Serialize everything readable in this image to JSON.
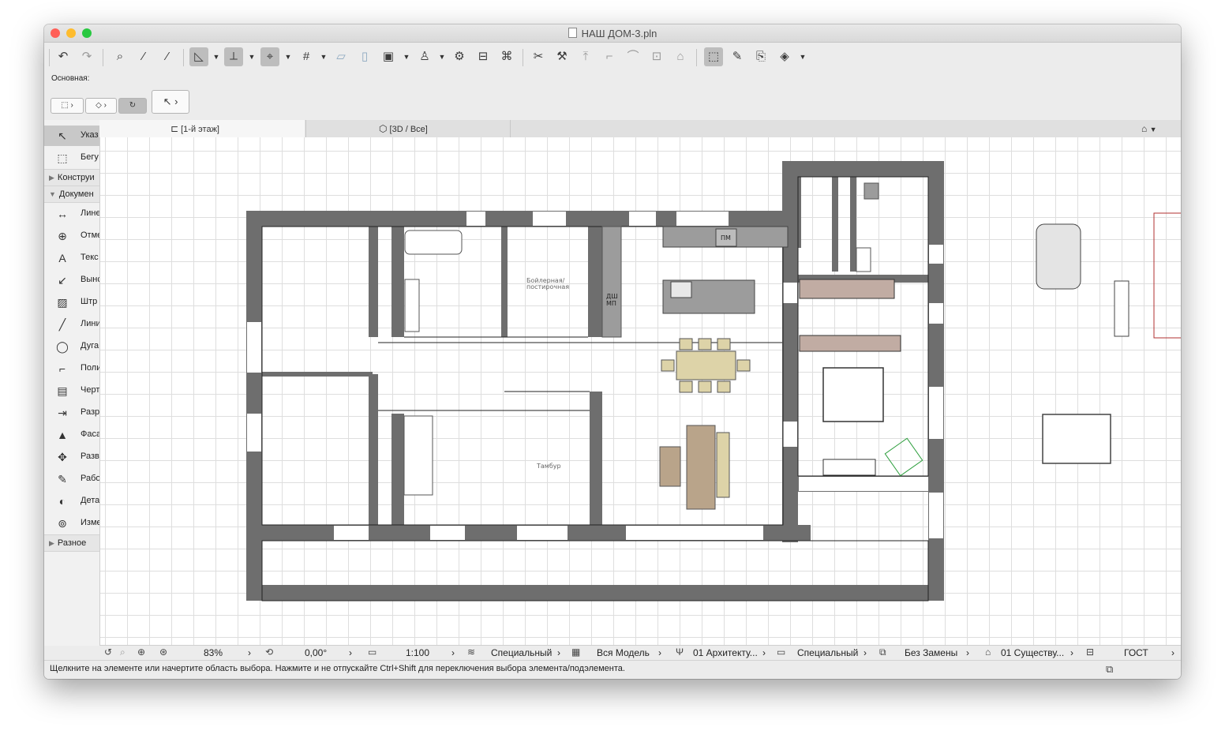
{
  "window": {
    "title": "НАШ ДОМ-3.pln"
  },
  "infobox": {
    "label": "Основная:"
  },
  "tabs": [
    {
      "label": "[1-й этаж]"
    },
    {
      "label": "[3D / Все]"
    }
  ],
  "toolbox": {
    "items": [
      {
        "icon": "arrow-pointer-icon",
        "label": "Указ"
      },
      {
        "icon": "marquee-icon",
        "label": "Бегу"
      }
    ],
    "sections": [
      {
        "label": "Конструи"
      },
      {
        "label": "Докумен"
      },
      {
        "label": "Разное"
      }
    ],
    "doc_tools": [
      {
        "icon": "dimension-icon",
        "label": "Лине"
      },
      {
        "icon": "level-mark-icon",
        "label": "Отме"
      },
      {
        "icon": "text-icon",
        "label": "Текс"
      },
      {
        "icon": "label-icon",
        "label": "Вынс"
      },
      {
        "icon": "hatch-icon",
        "label": "Штр"
      },
      {
        "icon": "line-icon",
        "label": "Лини"
      },
      {
        "icon": "arc-icon",
        "label": "Дуга"
      },
      {
        "icon": "polyline-icon",
        "label": "Поли"
      },
      {
        "icon": "drawing-icon",
        "label": "Черт"
      },
      {
        "icon": "section-icon",
        "label": "Разр"
      },
      {
        "icon": "elevation-icon",
        "label": "Фаса"
      },
      {
        "icon": "unfold-icon",
        "label": "Разв"
      },
      {
        "icon": "worksheet-icon",
        "label": "Рабо"
      },
      {
        "icon": "detail-icon",
        "label": "Дета"
      },
      {
        "icon": "change-icon",
        "label": "Изме"
      }
    ]
  },
  "plan": {
    "room_labels": [
      {
        "text": "Бойлерная/"
      },
      {
        "text": "постирочная"
      },
      {
        "text": "Тамбур"
      }
    ],
    "fixture_labels": [
      {
        "text": "ПМ"
      },
      {
        "text": "ДШ"
      },
      {
        "text": "МП"
      }
    ]
  },
  "statusbar": {
    "zoom": "83%",
    "angle": "0,00°",
    "scale": "1:100",
    "layers": "Специальный",
    "model_view": "Вся Модель",
    "pen_set": "01 Архитекту...",
    "display_option": "Специальный",
    "override": "Без Замены",
    "renovation": "01 Существу...",
    "dimension": "ГОСТ"
  },
  "hint": {
    "text": "Щелкните на элементе или начертите область выбора. Нажмите и не отпускайте Ctrl+Shift для переключения выбора элемента/подэлемента."
  },
  "colors": {
    "wall": "#6e6e6e",
    "table": "#ddd3a8",
    "sofa": "#b9a48a",
    "wardrobe": "#c1aca3",
    "close": "#ff5f57",
    "minimize": "#febc2e",
    "zoom": "#28c840"
  }
}
